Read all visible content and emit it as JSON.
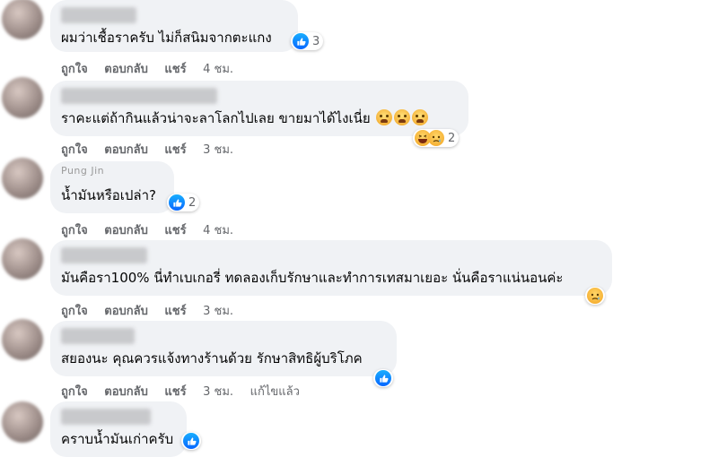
{
  "comments": [
    {
      "text": "ผมว่าเชื้อราครับ ไม่ก็สนิมจากตะแกง",
      "reactions": {
        "types": [
          "like"
        ],
        "count": "3"
      },
      "actions": {
        "like": "ถูกใจ",
        "reply": "ตอบกลับ",
        "share": "แชร์",
        "time": "4 ชม."
      }
    },
    {
      "text": "ราคะแต่ถ้ากินแล้วน่าจะลาโลกไปเลย ขายมาได้ไงเนี่ย",
      "inline_emojis": [
        "crying-face-icon",
        "crying-face-icon",
        "crying-face-icon"
      ],
      "reactions": {
        "types": [
          "haha",
          "sad"
        ],
        "count": "2"
      },
      "actions": {
        "like": "ถูกใจ",
        "reply": "ตอบกลับ",
        "share": "แชร์",
        "time": "3 ชม."
      }
    },
    {
      "name_partial": "Pung Jin",
      "text": "น้ำมันหรือเปล่า?",
      "reactions": {
        "types": [
          "like"
        ],
        "count": "2"
      },
      "actions": {
        "like": "ถูกใจ",
        "reply": "ตอบกลับ",
        "share": "แชร์",
        "time": "4 ชม."
      }
    },
    {
      "text": "มันคือรา100% นี่ทำเบเกอรี่ ทดลองเก็บรักษาและทำการเทสมาเยอะ นั่นคือราแน่นอนค่ะ",
      "reactions": {
        "types": [
          "sad"
        ],
        "count": ""
      },
      "actions": {
        "like": "ถูกใจ",
        "reply": "ตอบกลับ",
        "share": "แชร์",
        "time": "3 ชม."
      }
    },
    {
      "text": "สยองนะ คุณควรแจ้งทางร้านด้วย รักษาสิทธิผู้บริโภค",
      "reactions": {
        "types": [
          "like"
        ],
        "count": ""
      },
      "actions": {
        "like": "ถูกใจ",
        "reply": "ตอบกลับ",
        "share": "แชร์",
        "time": "3 ชม.",
        "edited": "แก้ไขแล้ว"
      }
    },
    {
      "text": "คราบน้ำมันเก่าครับ",
      "reactions": {
        "types": [
          "like"
        ],
        "count": ""
      }
    }
  ],
  "colors": {
    "bubble": "#f0f2f5",
    "action_text": "#65676b",
    "like_blue": "#0866ff"
  }
}
